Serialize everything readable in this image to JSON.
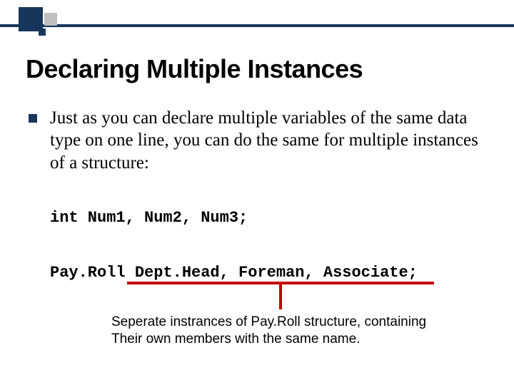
{
  "title": "Declaring Multiple Instances",
  "bullet": "Just as you can declare multiple variables of the same data type on one line, you can do the same for multiple instances of a structure:",
  "code_line_1": "int Num1, Num2, Num3;",
  "code_line_2": "Pay.Roll Dept.Head, Foreman, Associate;",
  "caption_line_1": "Seperate instrances of Pay.Roll structure, containing",
  "caption_line_2": "Their own members with the same name.",
  "colors": {
    "accent_dark": "#16365c",
    "accent_gray": "#c0c0c0",
    "annotation_red": "#c00000"
  }
}
